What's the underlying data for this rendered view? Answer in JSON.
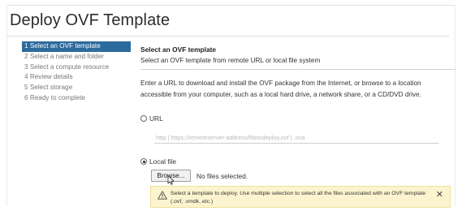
{
  "dialog": {
    "title": "Deploy OVF Template"
  },
  "steps": [
    {
      "label": "1 Select an OVF template",
      "active": true
    },
    {
      "label": "2 Select a name and folder",
      "active": false
    },
    {
      "label": "3 Select a compute resource",
      "active": false
    },
    {
      "label": "4 Review details",
      "active": false
    },
    {
      "label": "5 Select storage",
      "active": false
    },
    {
      "label": "6 Ready to complete",
      "active": false
    }
  ],
  "section": {
    "title": "Select an OVF template",
    "subtitle": "Select an OVF template from remote URL or local file system",
    "description": "Enter a URL to download and install the OVF package from the Internet, or browse to a location accessible from your computer, such as a local hard drive, a network share, or a CD/DVD drive."
  },
  "source": {
    "url_option_label": "URL",
    "url_selected": false,
    "url_placeholder": "http | https://remoteserver-address/filetodeploy.ovf | .ova",
    "local_option_label": "Local file",
    "local_selected": true,
    "browse_label": "Browse...",
    "files_status": "No files selected."
  },
  "alert": {
    "type": "warning",
    "text": "Select a template to deploy. Use multiple selection to select all the files associated with an OVF template (.ovf, .vmdk, etc.)",
    "icon": "warning-triangle-icon",
    "close_icon": "close-icon"
  },
  "colors": {
    "active_step_bg": "#2d6a9d",
    "alert_bg": "#fcf4cf",
    "alert_border": "#efe09a"
  }
}
